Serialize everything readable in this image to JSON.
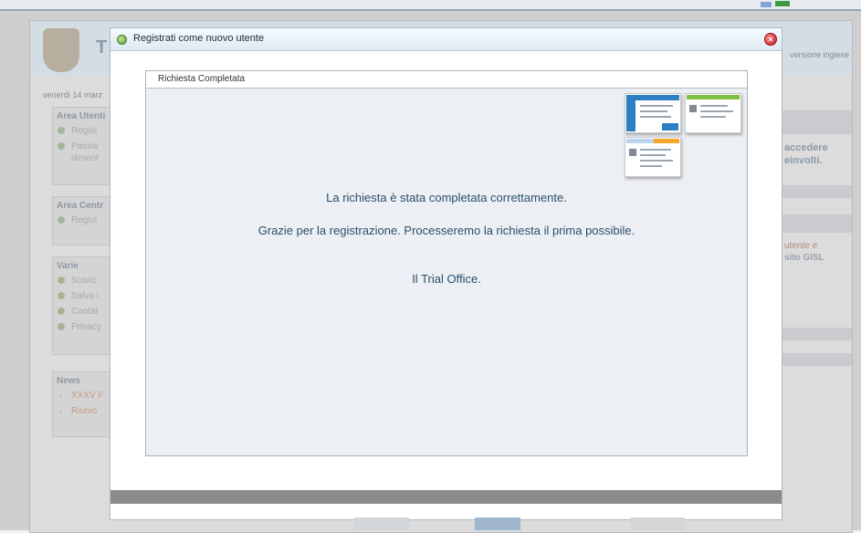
{
  "background": {
    "date_text": "venerdì 14 marz",
    "lang_link": "versione inglese",
    "site_title_initial": "T",
    "sidebar": [
      {
        "title": "Area Utenti",
        "items": [
          "Regist",
          "Passw",
          "diment"
        ]
      },
      {
        "title": "Area Centr",
        "items": [
          "Regist"
        ]
      },
      {
        "title": "Varie",
        "items": [
          "Scaric",
          "Salva i",
          "Contat",
          "Privacy"
        ]
      },
      {
        "title": "News",
        "items": [
          "XXXV F",
          "Riunio"
        ]
      }
    ],
    "right_text": [
      "accedere",
      "einvolti."
    ],
    "right_link": [
      "utente e",
      "sito GISL"
    ]
  },
  "modal": {
    "title": "Registrati come nuovo utente",
    "close_label": "×",
    "panel_title": "Richiesta Completata",
    "messages": {
      "completed": "La richiesta è stata completata correttamente.",
      "thanks": "Grazie per la registrazione. Processeremo la richiesta il prima possibile.",
      "signature": "Il Trial Office."
    },
    "thumbnail_colors": [
      "#2d7fc4",
      "#7bc142",
      "#f4a62a"
    ]
  }
}
